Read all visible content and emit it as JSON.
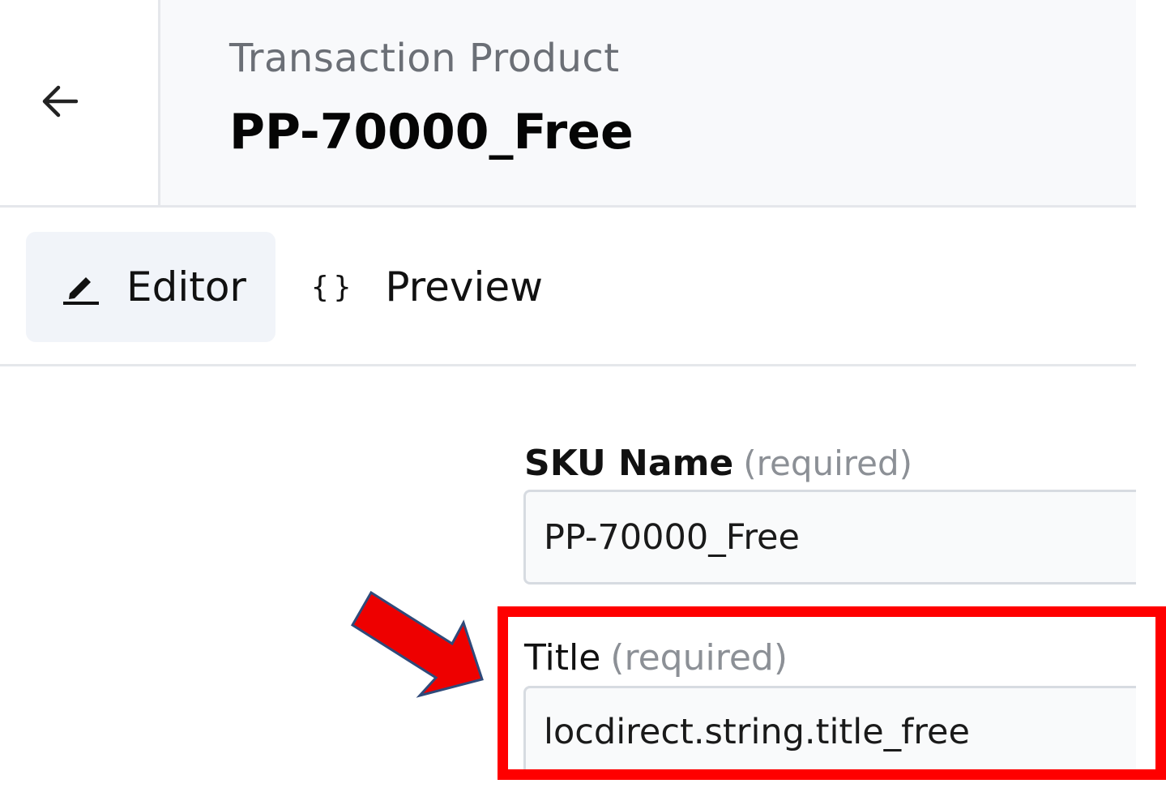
{
  "header": {
    "back_icon": "arrow-left-icon",
    "entity_type": "Transaction Product",
    "entity_name": "PP-70000_Free"
  },
  "tabs": [
    {
      "label": "Editor",
      "icon": "pencil-icon",
      "active": true
    },
    {
      "label": "Preview",
      "icon": "braces-icon",
      "active": false
    }
  ],
  "form": {
    "sku_name": {
      "label": "SKU Name",
      "required_note": "(required)",
      "value": "PP-70000_Free"
    },
    "title": {
      "label": "Title",
      "required_note": "(required)",
      "value": "locdirect.string.title_free"
    }
  },
  "annotation": {
    "highlight_color": "#ff0000",
    "arrow_fill": "#ee0000",
    "arrow_stroke": "#2f4a7a"
  }
}
